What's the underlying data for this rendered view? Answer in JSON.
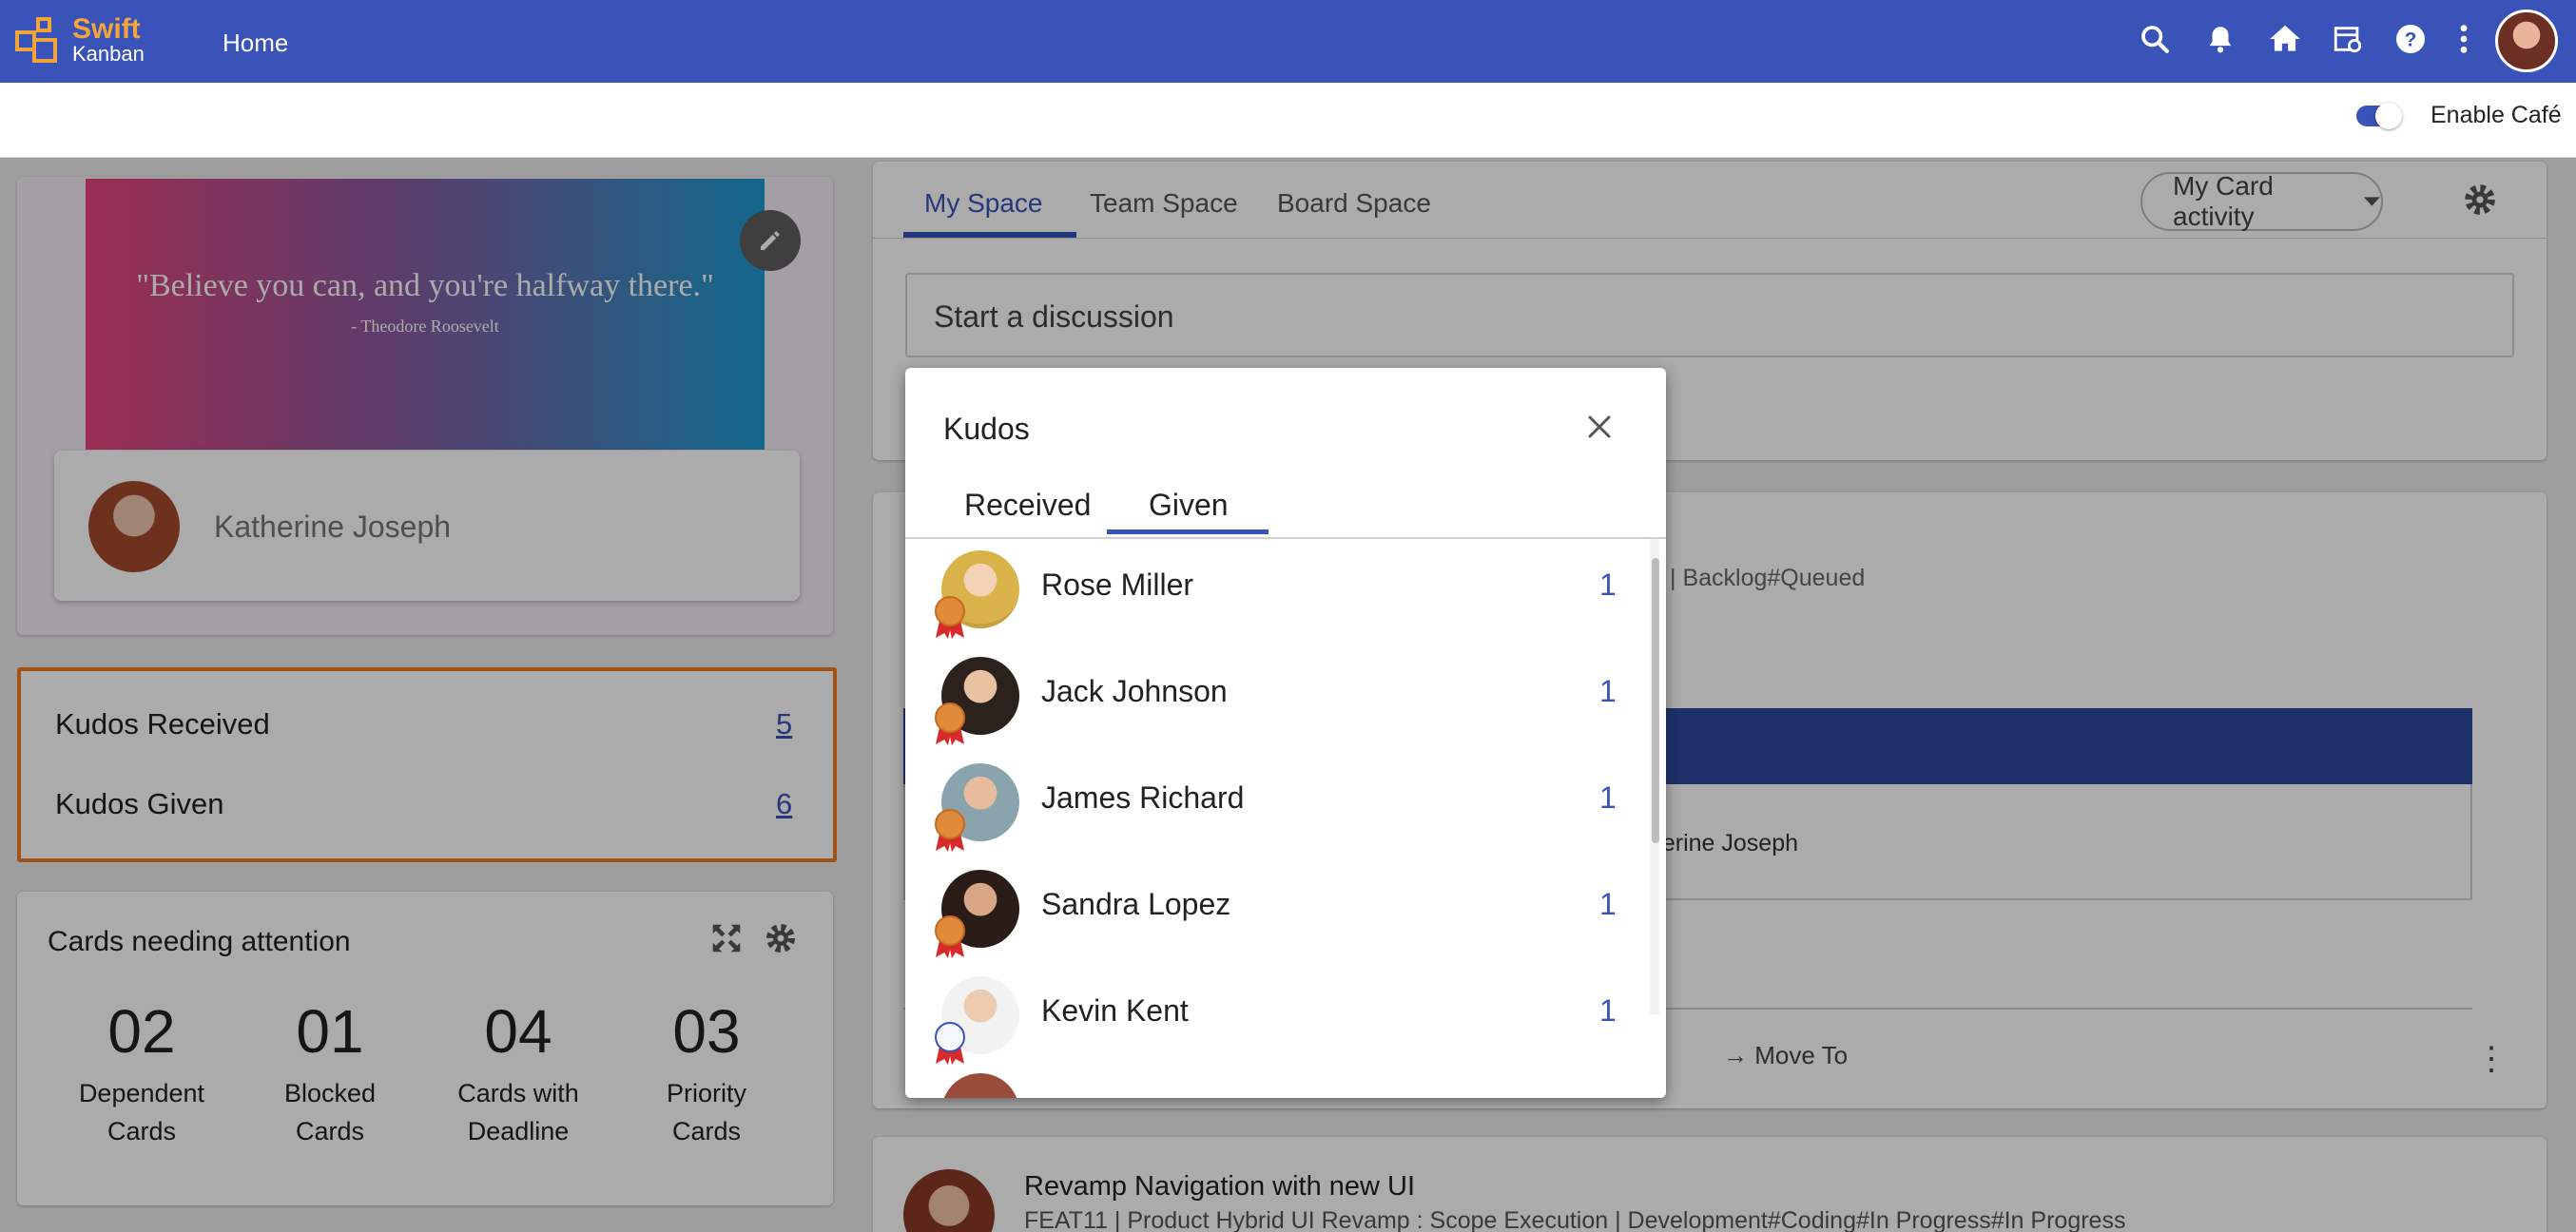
{
  "app": {
    "logo_line1": "Swift",
    "logo_line2": "Kanban",
    "nav_home": "Home"
  },
  "topbar": {
    "icons": [
      "search-icon",
      "bell-icon",
      "home-icon",
      "calendar-icon",
      "help-icon",
      "more-vertical-icon"
    ]
  },
  "subbar": {
    "cafe_label": "Enable Café",
    "cafe_enabled": true
  },
  "quote": {
    "text": "\"Believe you can, and you're halfway there.\"",
    "author": "- Theodore Roosevelt"
  },
  "profile": {
    "name": "Katherine Joseph"
  },
  "kudos_summary": {
    "received_label": "Kudos Received",
    "received_count": "5",
    "given_label": "Kudos Given",
    "given_count": "6"
  },
  "attention": {
    "title": "Cards needing attention",
    "stats": [
      {
        "value": "02",
        "line1": "Dependent",
        "line2": "Cards"
      },
      {
        "value": "01",
        "line1": "Blocked",
        "line2": "Cards"
      },
      {
        "value": "04",
        "line1": "Cards with",
        "line2": "Deadline"
      },
      {
        "value": "03",
        "line1": "Priority",
        "line2": "Cards"
      }
    ]
  },
  "space": {
    "tabs": [
      "My Space",
      "Team Space",
      "Board Space"
    ],
    "active_tab": "My Space",
    "activity_select": "My Card activity",
    "discussion_placeholder": "Start a discussion"
  },
  "feed": {
    "item1_path": "| Backlog#Queued",
    "item1_name": "therine Joseph",
    "move_to": "Move To",
    "item2_title": "Revamp Navigation with new UI",
    "item2_path": "FEAT11   |   Product Hybrid UI Revamp : Scope Execution | Development#Coding#In Progress#In Progress"
  },
  "modal": {
    "title": "Kudos",
    "tabs": [
      "Received",
      "Given"
    ],
    "active_tab": "Given",
    "people": [
      {
        "name": "Rose Miller",
        "count": "1",
        "badge": "gold"
      },
      {
        "name": "Jack Johnson",
        "count": "1",
        "badge": "gold"
      },
      {
        "name": "James Richard",
        "count": "1",
        "badge": "gold"
      },
      {
        "name": "Sandra Lopez",
        "count": "1",
        "badge": "gold"
      },
      {
        "name": "Kevin Kent",
        "count": "1",
        "badge": "silver"
      }
    ]
  },
  "colors": {
    "primary": "#3953b9",
    "accent": "#f3a53c",
    "highlight_border": "#f07c21",
    "badge_gold": "#e08a3c",
    "badge_ribbon": "#d62b2b"
  }
}
